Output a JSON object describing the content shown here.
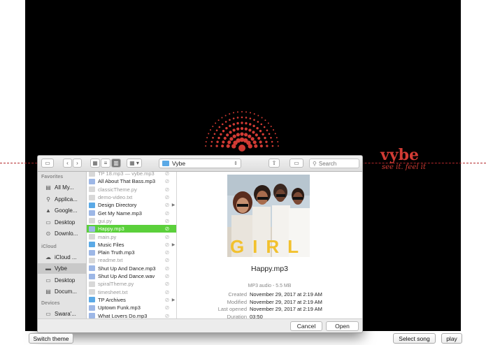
{
  "app": {
    "brand": {
      "name": "vybe",
      "tagline": "see it. feel it"
    },
    "buttons": {
      "switch_theme": "Switch theme",
      "select_song": "Select song",
      "play": "play"
    },
    "colors": {
      "brand_red": "#d23b34",
      "background": "#000000",
      "selection_green": "#5bd03b"
    }
  },
  "dialog": {
    "toolbar": {
      "current_folder": "Vybe",
      "search_placeholder": "Search",
      "icons": [
        "sidebar-toggle-icon",
        "back-icon",
        "forward-icon",
        "icon-view-icon",
        "list-view-icon",
        "column-view-icon",
        "group-by-icon",
        "folder-icon",
        "share-icon",
        "tag-icon",
        "search-icon"
      ]
    },
    "sidebar": {
      "favorites_header": "Favorites",
      "favorites": [
        {
          "label": "All My...",
          "icon": "all-files-icon"
        },
        {
          "label": "Applica...",
          "icon": "applications-icon"
        },
        {
          "label": "Google...",
          "icon": "google-drive-icon"
        },
        {
          "label": "Desktop",
          "icon": "desktop-icon"
        },
        {
          "label": "Downlo...",
          "icon": "downloads-icon"
        }
      ],
      "icloud_header": "iCloud",
      "icloud": [
        {
          "label": "iCloud ...",
          "icon": "cloud-icon"
        },
        {
          "label": "Vybe",
          "icon": "folder-icon",
          "selected": true
        },
        {
          "label": "Desktop",
          "icon": "desktop-icon"
        },
        {
          "label": "Docum...",
          "icon": "documents-icon"
        }
      ],
      "devices_header": "Devices",
      "devices": [
        {
          "label": "Swara'...",
          "icon": "laptop-icon"
        }
      ]
    },
    "files": [
      {
        "name": "TP 18.mp3 — vybe.mp3",
        "type": "grey"
      },
      {
        "name": "All About That Bass.mp3",
        "type": "audio"
      },
      {
        "name": "classicTheme.py",
        "type": "grey"
      },
      {
        "name": "demo-video.txt",
        "type": "grey"
      },
      {
        "name": "Design Directory",
        "type": "folder",
        "arrow": true
      },
      {
        "name": "Get My Name.mp3",
        "type": "audio"
      },
      {
        "name": "gui.py",
        "type": "grey"
      },
      {
        "name": "Happy.mp3",
        "type": "audio",
        "selected": true
      },
      {
        "name": "main.py",
        "type": "grey"
      },
      {
        "name": "Music Files",
        "type": "folder",
        "arrow": true
      },
      {
        "name": "Plain Truth.mp3",
        "type": "audio"
      },
      {
        "name": "readme.txt",
        "type": "grey"
      },
      {
        "name": "Shut Up And Dance.mp3",
        "type": "audio"
      },
      {
        "name": "Shut Up And Dance.wav",
        "type": "audio"
      },
      {
        "name": "spiralTheme.py",
        "type": "grey"
      },
      {
        "name": "timesheet.txt",
        "type": "grey"
      },
      {
        "name": "TP Archives",
        "type": "folder",
        "arrow": true
      },
      {
        "name": "Uptown Funk.mp3",
        "type": "audio"
      },
      {
        "name": "What Lovers Do.mp3",
        "type": "audio"
      }
    ],
    "preview": {
      "album_text": "GIRL",
      "file_name": "Happy.mp3",
      "kind": "MP3 audio - 5.5 MB",
      "details": [
        {
          "key": "Created",
          "value": "November 29, 2017 at 2:19 AM"
        },
        {
          "key": "Modified",
          "value": "November 29, 2017 at 2:19 AM"
        },
        {
          "key": "Last opened",
          "value": "November 29, 2017 at 2:19 AM"
        },
        {
          "key": "Duration",
          "value": "03:50"
        }
      ]
    },
    "footer": {
      "cancel": "Cancel",
      "open": "Open"
    }
  }
}
